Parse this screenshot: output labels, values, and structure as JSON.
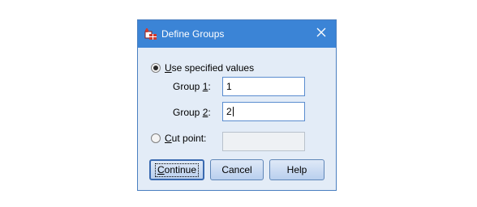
{
  "dialog": {
    "title": "Define Groups",
    "icon": "spss-define-groups-icon",
    "close_icon": "close-icon"
  },
  "options": {
    "use_specified": {
      "accel": "U",
      "rest": "se specified values",
      "checked": true
    },
    "group1": {
      "pre": "Group ",
      "accel": "1",
      "post": ":",
      "value": "1"
    },
    "group2": {
      "pre": "Group ",
      "accel": "2",
      "post": ":",
      "value": "2"
    },
    "cut_point": {
      "accel": "C",
      "rest": "ut point:",
      "checked": false,
      "value": ""
    }
  },
  "buttons": {
    "continue": {
      "accel": "C",
      "rest": "ontinue"
    },
    "cancel": "Cancel",
    "help": "Help"
  },
  "colors": {
    "titlebar": "#3b84d6",
    "dialog_bg": "#e3ecf7",
    "input_border": "#5a8ccf"
  }
}
